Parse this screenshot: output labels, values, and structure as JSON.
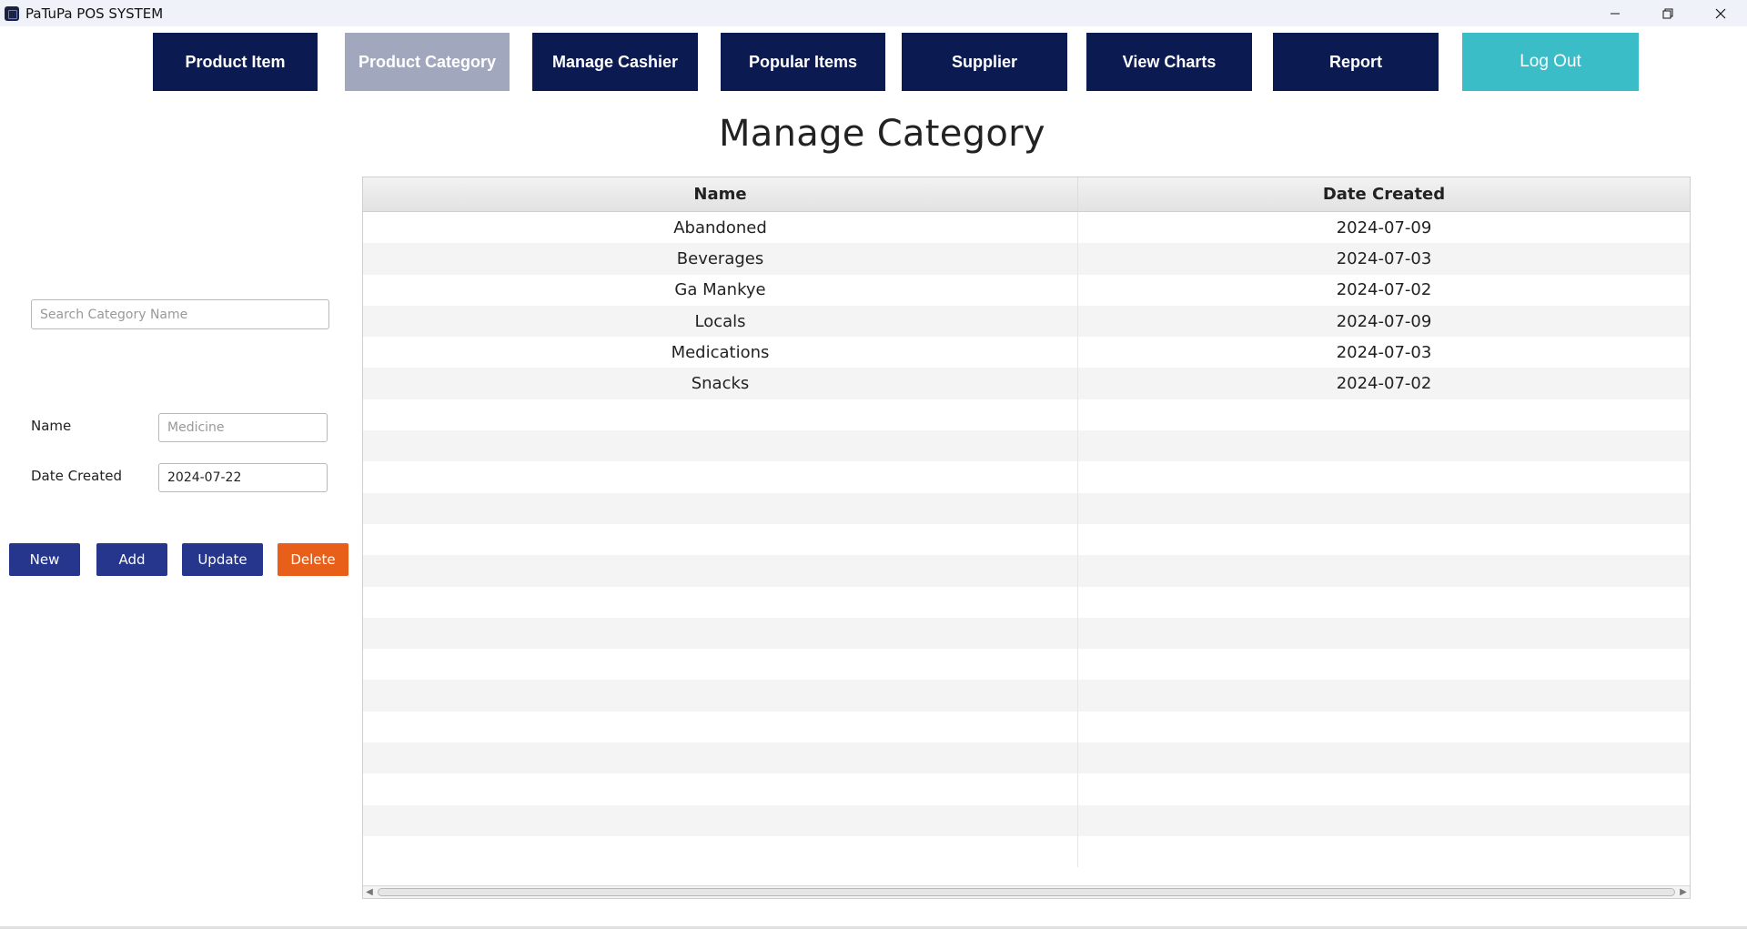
{
  "window": {
    "title": "PaTuPa POS SYSTEM",
    "controls": [
      "minimize-icon",
      "restore-icon",
      "close-icon"
    ]
  },
  "nav": {
    "items": [
      {
        "label": "Product Item",
        "active": false
      },
      {
        "label": "Product Category",
        "active": true
      },
      {
        "label": "Manage Cashier",
        "active": false
      },
      {
        "label": "Popular Items",
        "active": false
      },
      {
        "label": "Supplier",
        "active": false
      },
      {
        "label": "View Charts",
        "active": false
      },
      {
        "label": "Report",
        "active": false
      },
      {
        "label": "Log Out",
        "active": false
      }
    ]
  },
  "page": {
    "title": "Manage Category"
  },
  "form": {
    "search_placeholder": "Search Category Name",
    "name_label": "Name",
    "name_placeholder": "Medicine",
    "date_label": "Date Created",
    "date_value": "2024-07-22",
    "buttons": {
      "new": "New",
      "add": "Add",
      "update": "Update",
      "delete": "Delete"
    }
  },
  "table": {
    "columns": [
      "Name",
      "Date Created"
    ],
    "rows": [
      [
        "Abandoned",
        "2024-07-09"
      ],
      [
        "Beverages",
        "2024-07-03"
      ],
      [
        "Ga Mankye",
        "2024-07-02"
      ],
      [
        "Locals",
        "2024-07-09"
      ],
      [
        "Medications",
        "2024-07-03"
      ],
      [
        "Snacks",
        "2024-07-02"
      ]
    ]
  },
  "colors": {
    "nav": "#0c1a52",
    "nav_active": "#a1a7bd",
    "logout": "#3bbdc7",
    "button_blue": "#25368c",
    "button_delete": "#e85f1a"
  }
}
